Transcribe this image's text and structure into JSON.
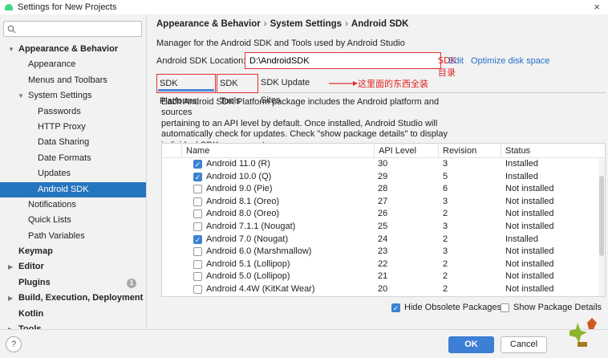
{
  "window": {
    "title": "Settings for New Projects",
    "close": "×"
  },
  "sidebar": {
    "search_placeholder": "",
    "items": [
      {
        "label": "Appearance & Behavior",
        "level": 0,
        "bold": true,
        "arrow": "▼"
      },
      {
        "label": "Appearance",
        "level": 1
      },
      {
        "label": "Menus and Toolbars",
        "level": 1
      },
      {
        "label": "System Settings",
        "level": 1,
        "arrow": "▼"
      },
      {
        "label": "Passwords",
        "level": 2
      },
      {
        "label": "HTTP Proxy",
        "level": 2
      },
      {
        "label": "Data Sharing",
        "level": 2
      },
      {
        "label": "Date Formats",
        "level": 2
      },
      {
        "label": "Updates",
        "level": 2
      },
      {
        "label": "Android SDK",
        "level": 2,
        "selected": true
      },
      {
        "label": "Notifications",
        "level": 1
      },
      {
        "label": "Quick Lists",
        "level": 1
      },
      {
        "label": "Path Variables",
        "level": 1
      },
      {
        "label": "Keymap",
        "level": 0,
        "bold": true
      },
      {
        "label": "Editor",
        "level": 0,
        "bold": true,
        "arrow": "▶"
      },
      {
        "label": "Plugins",
        "level": 0,
        "bold": true,
        "badge": "1"
      },
      {
        "label": "Build, Execution, Deployment",
        "level": 0,
        "bold": true,
        "arrow": "▶"
      },
      {
        "label": "Kotlin",
        "level": 0,
        "bold": true
      },
      {
        "label": "Tools",
        "level": 0,
        "bold": true,
        "arrow": "▶"
      }
    ]
  },
  "breadcrumb": {
    "a": "Appearance & Behavior",
    "b": "System Settings",
    "c": "Android SDK",
    "sep": "›"
  },
  "description": "Manager for the Android SDK and Tools used by Android Studio",
  "location": {
    "label": "Android SDK Location:",
    "value": "D:\\AndroidSDK",
    "annotation": "SDK目录",
    "edit": "Edit",
    "optimize": "Optimize disk space"
  },
  "tabs": [
    {
      "label": "SDK Platforms"
    },
    {
      "label": "SDK Tools"
    },
    {
      "label": "SDK Update Sites"
    }
  ],
  "tabs_annotation": "这里面的东西全装",
  "info_lines": [
    "Each Android SDK Platform package includes the Android platform and sources",
    "pertaining to an API level by default. Once installed, Android Studio will",
    "automatically check for updates. Check \"show package details\" to display",
    "individual SDK components."
  ],
  "table": {
    "headers": {
      "name": "Name",
      "api": "API Level",
      "revision": "Revision",
      "status": "Status"
    },
    "rows": [
      {
        "checked": true,
        "name": "Android 11.0 (R)",
        "api": "30",
        "revision": "3",
        "status": "Installed"
      },
      {
        "checked": true,
        "name": "Android 10.0 (Q)",
        "api": "29",
        "revision": "5",
        "status": "Installed"
      },
      {
        "checked": false,
        "name": "Android 9.0 (Pie)",
        "api": "28",
        "revision": "6",
        "status": "Not installed"
      },
      {
        "checked": false,
        "name": "Android 8.1 (Oreo)",
        "api": "27",
        "revision": "3",
        "status": "Not installed"
      },
      {
        "checked": false,
        "name": "Android 8.0 (Oreo)",
        "api": "26",
        "revision": "2",
        "status": "Not installed"
      },
      {
        "checked": false,
        "name": "Android 7.1.1 (Nougat)",
        "api": "25",
        "revision": "3",
        "status": "Not installed"
      },
      {
        "checked": true,
        "name": "Android 7.0 (Nougat)",
        "api": "24",
        "revision": "2",
        "status": "Installed"
      },
      {
        "checked": false,
        "name": "Android 6.0 (Marshmallow)",
        "api": "23",
        "revision": "3",
        "status": "Not installed"
      },
      {
        "checked": false,
        "name": "Android 5.1 (Lollipop)",
        "api": "22",
        "revision": "2",
        "status": "Not installed"
      },
      {
        "checked": false,
        "name": "Android 5.0 (Lollipop)",
        "api": "21",
        "revision": "2",
        "status": "Not installed"
      },
      {
        "checked": false,
        "name": "Android 4.4W (KitKat Wear)",
        "api": "20",
        "revision": "2",
        "status": "Not installed"
      }
    ]
  },
  "options": {
    "hide_obsolete": {
      "label": "Hide Obsolete Packages",
      "checked": true
    },
    "show_details": {
      "label": "Show Package Details",
      "checked": false
    }
  },
  "footer": {
    "help": "?",
    "ok": "OK",
    "cancel": "Cancel"
  },
  "checkmark": "✓",
  "colors": {
    "accent": "#2675bf",
    "annotation": "#e03030",
    "link": "#2470c8"
  }
}
